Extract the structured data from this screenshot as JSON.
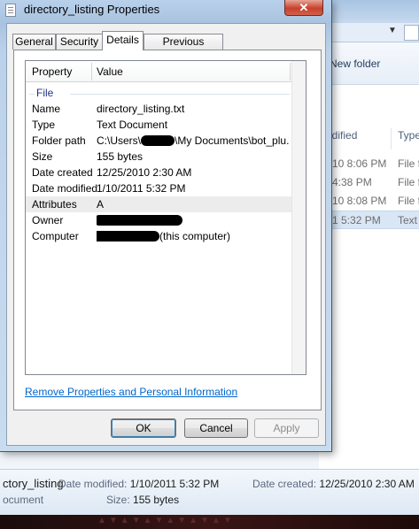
{
  "dialog": {
    "title": "directory_listing Properties",
    "close_symbol": "✕",
    "tabs": [
      "General",
      "Security",
      "Details",
      "Previous Versions"
    ],
    "active_tab": "Details",
    "columns": {
      "property": "Property",
      "value": "Value"
    },
    "group": "File",
    "rows": [
      {
        "name": "Name",
        "value": "directory_listing.txt"
      },
      {
        "name": "Type",
        "value": "Text Document"
      },
      {
        "name": "Folder path",
        "value_prefix": "C:\\Users\\",
        "value_suffix": "\\My Documents\\bot_plu..."
      },
      {
        "name": "Size",
        "value": "155 bytes"
      },
      {
        "name": "Date created",
        "value": "12/25/2010 2:30 AM"
      },
      {
        "name": "Date modified",
        "value": "1/10/2011 5:32 PM"
      },
      {
        "name": "Attributes",
        "value": "A"
      },
      {
        "name": "Owner",
        "value": ""
      },
      {
        "name": "Computer",
        "value_suffix": "(this computer)"
      }
    ],
    "remove_link": "Remove Properties and Personal Information",
    "buttons": {
      "ok": "OK",
      "cancel": "Cancel",
      "apply": "Apply"
    }
  },
  "explorer": {
    "toolbar_new_folder": "New folder",
    "column_modified": "odified",
    "column_type": "Type",
    "files": [
      {
        "date": "10 8:06 PM",
        "type": "File f"
      },
      {
        "date": "4:38 PM",
        "type": "File f"
      },
      {
        "date": "10 8:08 PM",
        "type": "File f"
      },
      {
        "date": "1 5:32 PM",
        "type": "Text"
      }
    ],
    "details": {
      "name": "ctory_listing",
      "type": "ocument",
      "date_modified_label": "Date modified:",
      "date_modified": "1/10/2011 5:32 PM",
      "date_created_label": "Date created:",
      "date_created": "12/25/2010 2:30 AM",
      "size_label": "Size:",
      "size": "155 bytes"
    }
  },
  "colors": {
    "link": "#0066cc",
    "group_header": "#1e3287",
    "close_button": "#c7412c"
  }
}
